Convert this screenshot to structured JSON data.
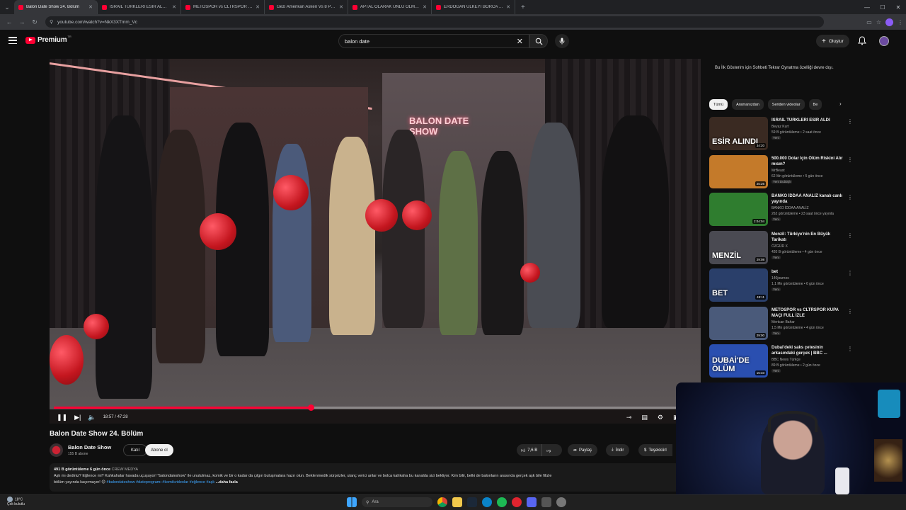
{
  "browser": {
    "tabs": [
      {
        "title": "Balon Date Show 24. Bölüm",
        "active": true
      },
      {
        "title": "İSRAİL TÜRKLERİ ESİR ALDI - Yo",
        "active": false
      },
      {
        "title": "METOSPOR vs CLTRSPOR KUPA",
        "active": false
      },
      {
        "title": "Gezi Amerikan Askeri Vs 8 Polis",
        "active": false
      },
      {
        "title": "APTAL OLARAK ÜNLÜ OLMAK",
        "active": false
      },
      {
        "title": "ERDOĞAN ÜLKEYİ BORCA SOK",
        "active": false
      }
    ],
    "url": "youtube.com/watch?v=NkX3XTmm_Vc"
  },
  "header": {
    "logo_text": "Premium",
    "logo_sup": "TR",
    "search_value": "balon date",
    "create_label": "Oluştur"
  },
  "player": {
    "neon_text": "BALON DATE SHOW",
    "time_current": "18:57",
    "time_total": "47:28",
    "time_display": "18:57 / 47:28",
    "progress_fraction": 0.4
  },
  "video": {
    "title": "Balon Date Show 24. Bölüm",
    "channel": "Balon Date Show",
    "subscribers": "155 B abone",
    "join_label": "Katıl",
    "subscribe_label": "Abone ol",
    "likes": "7,6 B",
    "share_label": "Paylaş",
    "download_label": "İndir",
    "thanks_label": "Teşekkürl"
  },
  "description": {
    "views_age": "491 B görüntüleme  6 gün önce",
    "tag": "CREW MEDYA",
    "text": "Aşk mı dediniz? Eğlence mi? Kahkahalar havada uçuşuyor! \"balondateshow\" ile unutulmaz, komik ve bir o kadar da çılgın buluşmalara hazır olun. Beklenmedik sürprizler, utanç verici anlar ve bolca kahkaha bu kanalda sizi bekliyor. Kim bilir, belki de balonların arasında gerçek aşk bile filizle",
    "text2": "bölüm yayında kaçırmayın! 😊",
    "hashtags": "#balondateshow #dateprogramı #komikvideolar #eğlence #aşk",
    "more": "...daha fazla"
  },
  "sidebar": {
    "livechat_note": "Bu İlk Gösterim için Sohbeti Tekrar Oynatma özelliği devre dışı.",
    "chips": [
      "Tümü",
      "Aramanızdan",
      "Seriden videolar",
      "Be"
    ],
    "recs": [
      {
        "title": "İSRAİL TÜRKLERİ ESİR ALDI",
        "channel": "Beyaz Kurt",
        "stats": "59 B görüntüleme • 2 saat önce",
        "badge": "Yeni",
        "duration": "34:20",
        "thumb_text": "ESİR ALINDI"
      },
      {
        "title": "500.000 Dolar İçin Ölüm Riskini Alır mısın?",
        "channel": "MrBeast",
        "stats": "62 Mn görüntüleme • 5 gün önce",
        "badge": "Yeni  Dublajlı",
        "duration": "25:26",
        "thumb_text": ""
      },
      {
        "title": "BANKO İDDAA ANALİZ kanalı canlı yayında",
        "channel": "BANKO İDDAA ANALİZ",
        "stats": "262 görüntüleme • 23 saat önce yayınla",
        "badge": "Yeni",
        "duration": "2:04:04",
        "thumb_text": ""
      },
      {
        "title": "Menzil: Türkiye'nin En Büyük Tarikatı",
        "channel": "ÖZGÜR X",
        "stats": "420 B görüntüleme • 4 gün önce",
        "badge": "Yeni",
        "duration": "29:08",
        "thumb_text": "MENZİL"
      },
      {
        "title": "bet",
        "channel": "140journos",
        "stats": "1,1 Mn görüntüleme • 6 gün önce",
        "badge": "Yeni",
        "duration": "48:11",
        "thumb_text": "BET"
      },
      {
        "title": "METOSPOR vs CLTRSPOR KUPA MAÇI FULL İZLE",
        "channel": "Mertcan Bahar",
        "stats": "1,5 Mn görüntüleme • 4 gün önce",
        "badge": "Yeni",
        "duration": "29:00",
        "thumb_text": ""
      },
      {
        "title": "Dubai'deki saks çetesinin arkasındaki gerçek | BBC ...",
        "channel": "BBC News Türkçe",
        "stats": "89 B görüntüleme • 2 gün önce",
        "badge": "Yeni",
        "duration": "15:33",
        "thumb_text": "DUBAİ'DE ÖLÜM"
      }
    ]
  },
  "taskbar": {
    "temp": "18°C",
    "weather": "Çok bulutlu",
    "search_label": "Ara"
  }
}
